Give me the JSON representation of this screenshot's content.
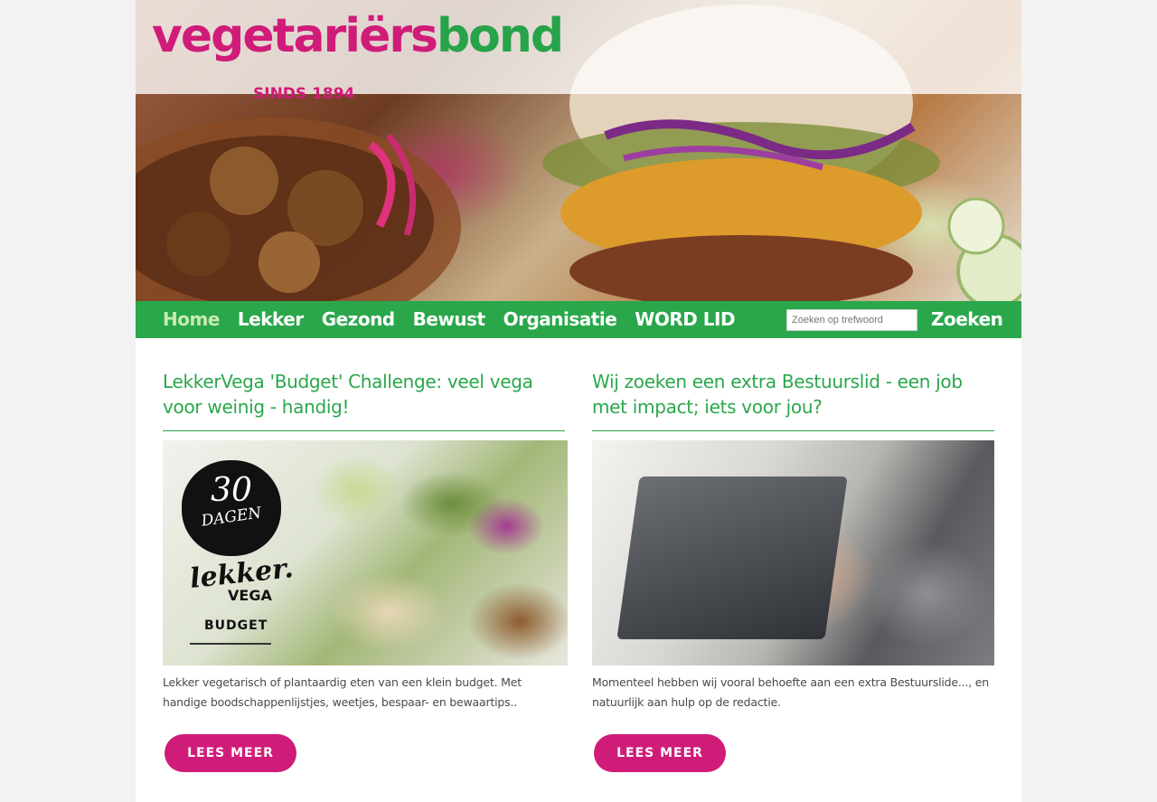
{
  "site": {
    "logo_pink": "vegetariërs",
    "logo_green": "bond",
    "logo_sub": "SINDS 1894"
  },
  "nav": {
    "items": [
      {
        "label": "Home"
      },
      {
        "label": "Lekker"
      },
      {
        "label": "Gezond"
      },
      {
        "label": "Bewust"
      },
      {
        "label": "Organisatie"
      },
      {
        "label": "WORD LID"
      }
    ],
    "search_placeholder": "Zoeken op trefwoord",
    "search_button": "Zoeken"
  },
  "articles": [
    {
      "title": "LekkerVega 'Budget' Challenge: veel vega voor weinig - handig!",
      "excerpt": "Lekker vegetarisch of plantaardig eten van een klein budget. Met handige boodschappenlijstjes, weetjes, bespaar- en bewaartips..",
      "button": "LEES MEER",
      "image_badge_number": "30",
      "image_badge_word": "DAGEN",
      "image_brand": "lekker.",
      "image_brand_sub": "VEGA",
      "image_caption": "BUDGET"
    },
    {
      "title": "Wij zoeken een extra Bestuurslid - een job met impact; iets voor jou?",
      "excerpt": "Momenteel hebben wij vooral behoefte aan een extra Bestuurslide..., en natuurlijk aan hulp op de redactie.",
      "button": "LEES MEER"
    }
  ],
  "colors": {
    "brand_green": "#2aa74b",
    "brand_pink": "#d01c79",
    "nav_active": "#c9e9b4"
  }
}
